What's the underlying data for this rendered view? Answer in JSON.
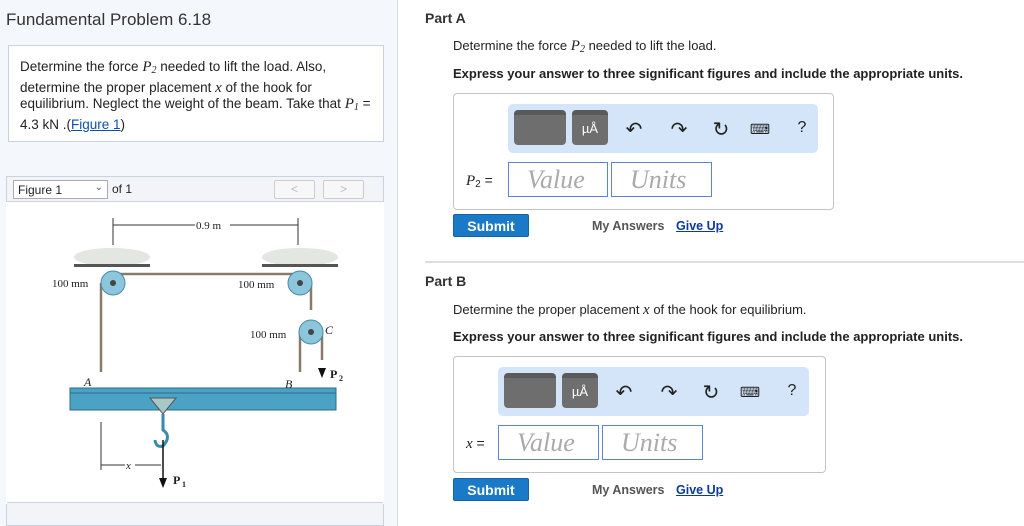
{
  "left": {
    "title": "Fundamental Problem 6.18",
    "problem": {
      "t1": "Determine the force ",
      "p2": "P",
      "p2sub": "2",
      "t2": " needed to lift the load. Also, determine the proper placement ",
      "x": "x",
      "t3": " of the hook for equilibrium. Neglect the weight of the beam. Take that ",
      "p1": "P",
      "p1sub": "1",
      "t4": " = 4.3 kN .(",
      "link": "Figure 1",
      "t5": ")"
    },
    "figure": {
      "select": "Figure 1",
      "of": "of 1",
      "prev": "<",
      "next": ">",
      "labels": {
        "dist": "0.9 m",
        "mm1": "100 mm",
        "mm2": "100 mm",
        "mm3": "100 mm",
        "A": "A",
        "B": "B",
        "C": "C",
        "P1": "P",
        "P1sub": "1",
        "P2": "P",
        "P2sub": "2",
        "x": "x"
      }
    }
  },
  "partA": {
    "title": "Part A",
    "q1": "Determine the force ",
    "var": "P",
    "varsub": "2",
    "q2": " needed to lift the load.",
    "instr": "Express your answer to three significant figures and include the appropriate units.",
    "label_eq": " =",
    "value_ph": "Value",
    "units_ph": "Units",
    "submit": "Submit",
    "my_answers": "My Answers",
    "give_up": "Give Up",
    "help": "?"
  },
  "partB": {
    "title": "Part B",
    "q1": "Determine the proper placement ",
    "var": "x",
    "q2": " of the hook for equilibrium.",
    "instr": "Express your answer to three significant figures and include the appropriate units.",
    "label_eq": " =",
    "value_ph": "Value",
    "units_ph": "Units",
    "submit": "Submit",
    "my_answers": "My Answers",
    "give_up": "Give Up",
    "help": "?"
  },
  "colors": {
    "accent": "#1b7ac7",
    "toolbar": "#d4e5f9",
    "beam": "#4aa3c4"
  }
}
